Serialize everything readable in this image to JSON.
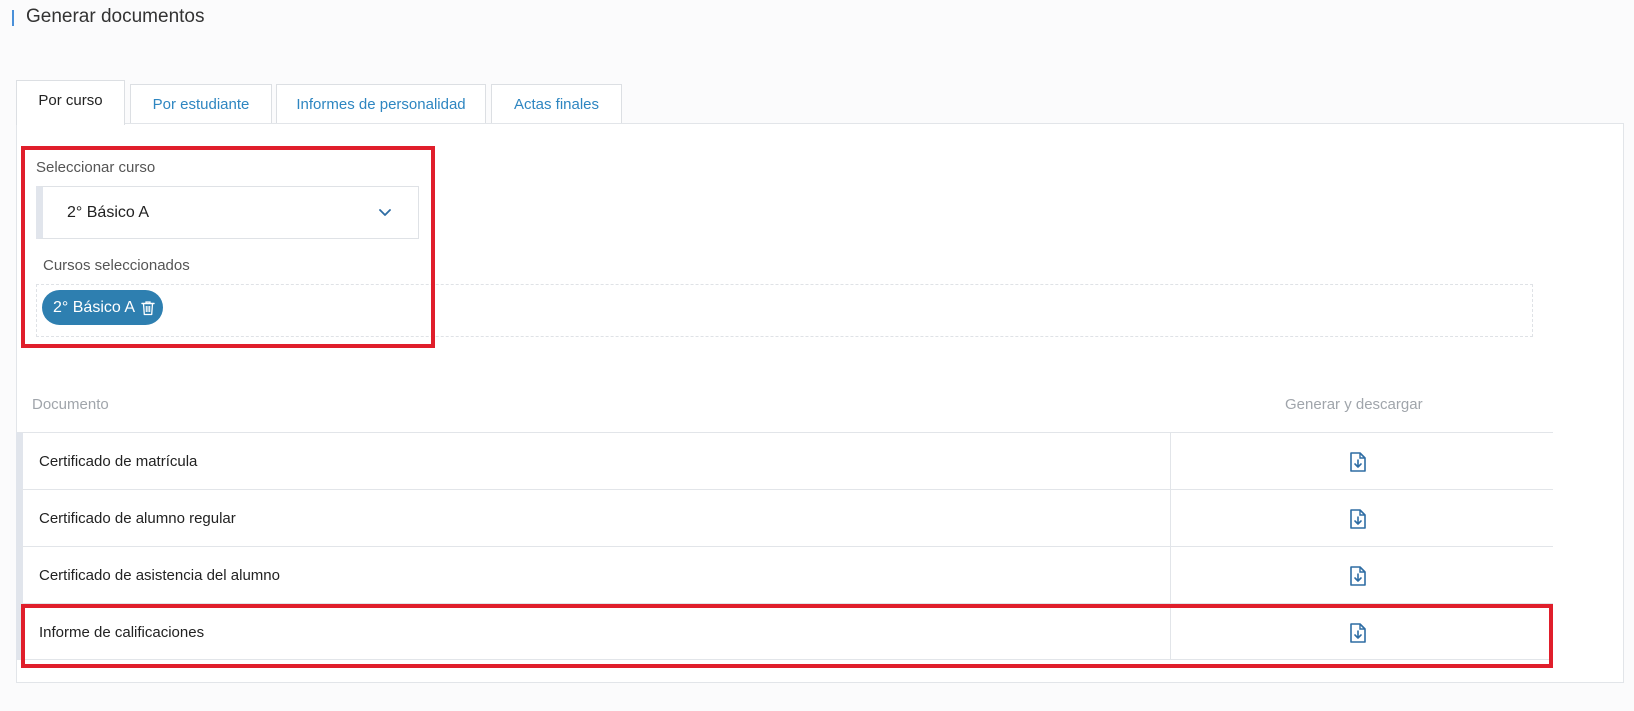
{
  "header": {
    "title": "Generar documentos"
  },
  "tabs": [
    {
      "label": "Por curso",
      "active": true
    },
    {
      "label": "Por estudiante",
      "active": false
    },
    {
      "label": "Informes de personalidad",
      "active": false
    },
    {
      "label": "Actas finales",
      "active": false
    }
  ],
  "course_select": {
    "label": "Seleccionar curso",
    "value": "2° Básico A",
    "icon": "chevron-down-icon"
  },
  "selected_courses": {
    "label": "Cursos seleccionados",
    "chips": [
      {
        "label": "2° Básico A",
        "icon": "trash-icon"
      }
    ]
  },
  "documents_table": {
    "columns": [
      "Documento",
      "Generar y descargar"
    ],
    "rows": [
      {
        "document": "Certificado de matrícula",
        "action_icon": "download-file-icon"
      },
      {
        "document": "Certificado de alumno regular",
        "action_icon": "download-file-icon"
      },
      {
        "document": "Certificado de asistencia del alumno",
        "action_icon": "download-file-icon"
      },
      {
        "document": "Informe de calificaciones",
        "action_icon": "download-file-icon"
      }
    ]
  },
  "colors": {
    "accent": "#2e86c1",
    "chip": "#2e7fb0",
    "highlight": "#e01e2b"
  }
}
